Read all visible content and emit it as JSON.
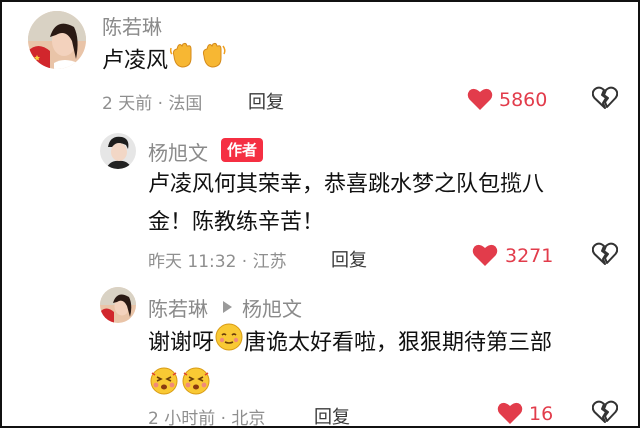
{
  "comments": [
    {
      "username": "陈若琳",
      "text_before_emoji": "卢凌风",
      "emojis": [
        "waving-hand-emoji",
        "waving-hand-emoji"
      ],
      "meta": "2 天前 · 法国",
      "reply_label": "回复",
      "likes": "5860"
    },
    {
      "username": "杨旭文",
      "author_badge": "作者",
      "text_line1": "卢凌风何其荣幸，恭喜跳水梦之队包揽八",
      "text_line2": "金！陈教练辛苦！",
      "meta": "昨天 11:32 · 江苏",
      "reply_label": "回复",
      "likes": "3271"
    },
    {
      "username": "陈若琳",
      "reply_to": "杨旭文",
      "text_part1": "谢谢呀",
      "text_part2": "唐诡太好看啦，狠狠期待第三部",
      "emojis": [
        "shy-smile-emoji",
        "blush-face-emoji",
        "blush-face-emoji"
      ],
      "meta": "2 小时前 · 北京",
      "reply_label": "回复",
      "likes": "16"
    }
  ],
  "colors": {
    "like_red": "#e23c4b",
    "badge_red": "#f52f42",
    "meta_gray": "#8f8f8f"
  }
}
